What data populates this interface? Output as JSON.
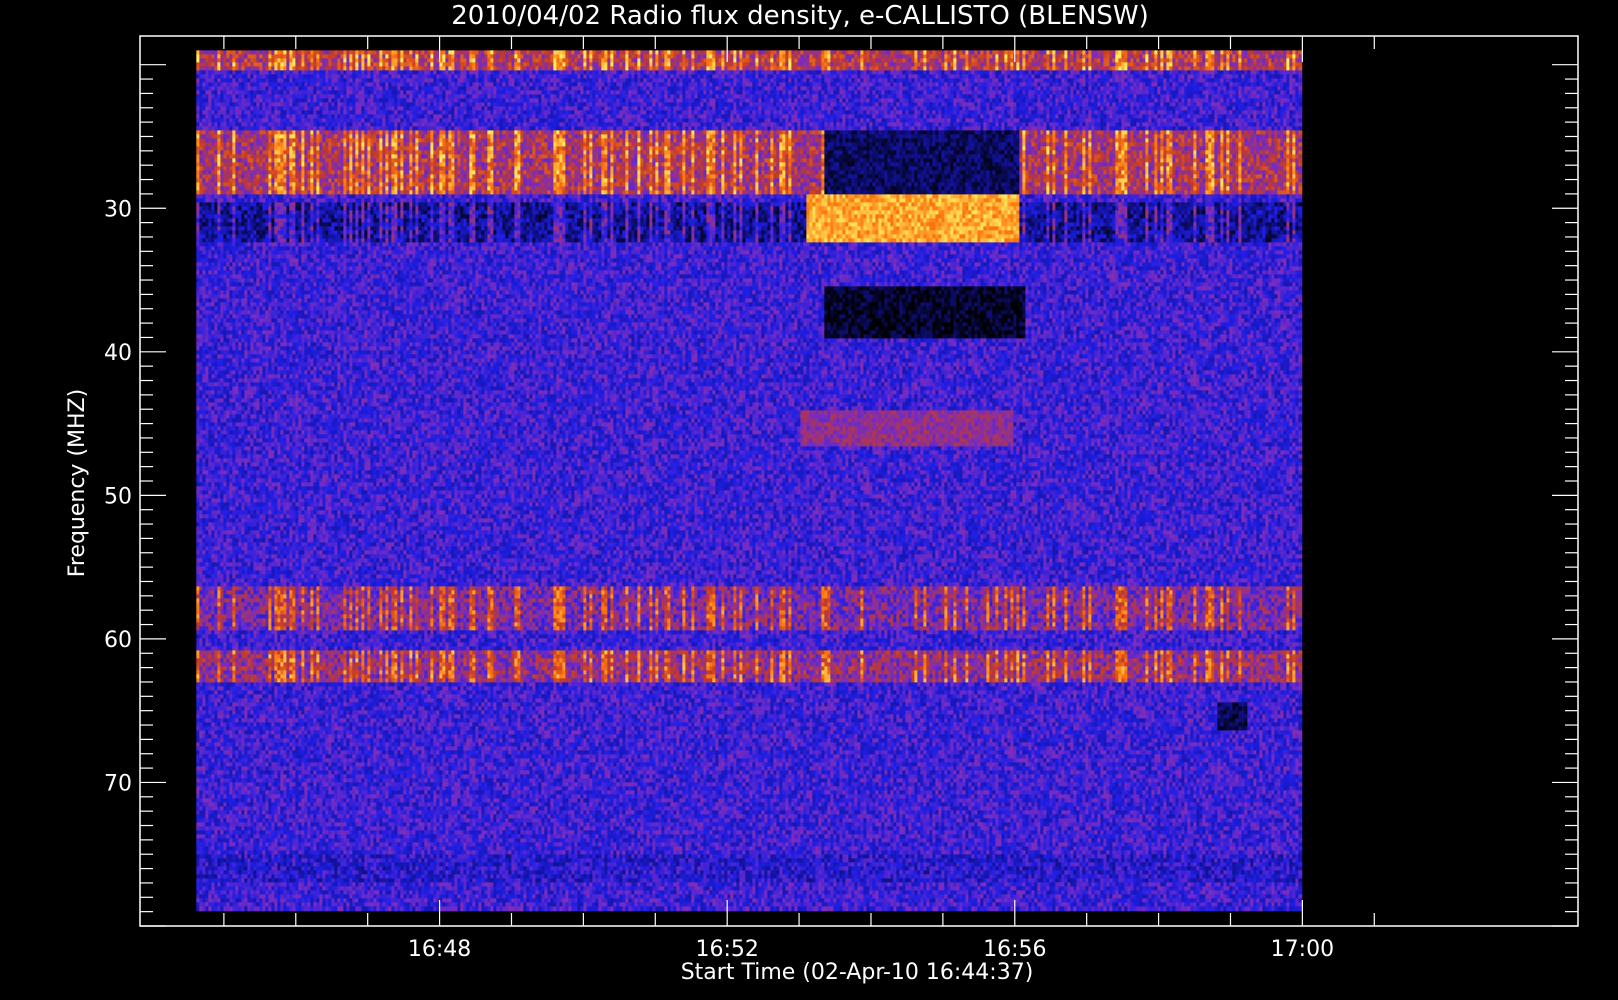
{
  "chart_data": {
    "type": "heatmap",
    "title": "2010/04/02  Radio flux density, e-CALLISTO (BLENSW)",
    "xlabel": "Start Time (02-Apr-10 16:44:37)",
    "ylabel": "Frequency (MHZ)",
    "x_axis": {
      "unit": "time (HH:MM)",
      "range": [
        "16:44:37",
        "17:00:00"
      ],
      "frame_range": [
        "16:43:50",
        "17:03:50"
      ],
      "tick_labels": [
        "16:48",
        "16:52",
        "16:56",
        "17:00"
      ]
    },
    "y_axis": {
      "unit": "MHz",
      "orientation": "inverted (frequency increases downward)",
      "range": [
        19,
        79
      ],
      "frame_range": [
        18,
        80
      ],
      "tick_labels": [
        "30",
        "40",
        "50",
        "60",
        "70"
      ],
      "tick_values": [
        30,
        40,
        50,
        60,
        70
      ]
    },
    "colormap": [
      "#000000",
      "#10108a",
      "#1e1ee6",
      "#7a2cc0",
      "#c23a28",
      "#ff7a10",
      "#ffee60"
    ],
    "background_level": 0.38,
    "features": [
      {
        "label": "bright burst (emission)",
        "t_start": "16:53:05",
        "t_end": "16:56:05",
        "f_low": 29.0,
        "f_high": 32.5,
        "intensity": 0.9
      },
      {
        "label": "dark absorption band",
        "t_start": "16:53:20",
        "t_end": "16:56:10",
        "f_low": 35.5,
        "f_high": 39.0,
        "intensity": 0.05
      },
      {
        "label": "faint enhancement",
        "t_start": "16:53:00",
        "t_end": "16:56:00",
        "f_low": 44.0,
        "f_high": 46.5,
        "intensity": 0.55
      },
      {
        "label": "dark gap",
        "t_start": "16:53:20",
        "t_end": "16:56:05",
        "f_low": 24.5,
        "f_high": 29.0,
        "intensity": 0.12
      },
      {
        "label": "dark patch",
        "t_start": "16:58:50",
        "t_end": "16:59:15",
        "f_low": 64.5,
        "f_high": 66.5,
        "intensity": 0.1
      }
    ],
    "bands": [
      {
        "f_low": 19.0,
        "f_high": 20.5,
        "intensity": 0.62,
        "streaky": true
      },
      {
        "f_low": 24.5,
        "f_high": 29.0,
        "intensity": 0.6,
        "streaky": true
      },
      {
        "f_low": 29.5,
        "f_high": 32.5,
        "intensity": 0.2,
        "streaky": true
      },
      {
        "f_low": 56.5,
        "f_high": 59.5,
        "intensity": 0.5,
        "streaky": true
      },
      {
        "f_low": 61.0,
        "f_high": 63.0,
        "intensity": 0.55,
        "streaky": true
      },
      {
        "f_low": 75.0,
        "f_high": 77.0,
        "intensity": 0.32,
        "streaky": false
      }
    ]
  }
}
